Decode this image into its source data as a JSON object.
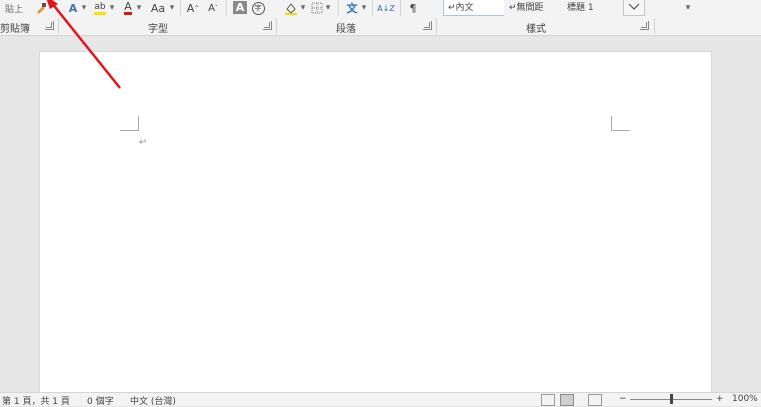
{
  "ribbon": {
    "clipboard": {
      "label": "剪貼簿",
      "paste_label": "貼上",
      "format_painter_icon": "format-painter-icon"
    },
    "font": {
      "label": "字型",
      "text_effects": "A",
      "highlight": "ab",
      "font_color": "A",
      "change_case": "Aa",
      "grow": "A",
      "shrink": "A",
      "char_shading": "A",
      "enclose": "字",
      "dropdown": "▾"
    },
    "paragraph": {
      "label": "段落",
      "shading_icon": "shading-icon",
      "borders_icon": "borders-icon",
      "asian_layout": "文",
      "sort": "A↓Z",
      "show_marks": "¶"
    },
    "styles": {
      "label": "樣式",
      "items": [
        "↵內文",
        "↵無間距",
        "標題 1"
      ],
      "more": "▾"
    }
  },
  "document": {
    "paragraph_mark": "↵"
  },
  "status_bar": {
    "page_info": "第 1 頁，共 1 頁",
    "word_count": "0 個字",
    "language": "中文 (台灣)",
    "zoom_minus": "−",
    "zoom_plus": "+",
    "zoom_level": "100%",
    "zoom_fraction": 0.5
  },
  "annotation": {
    "color": "#e3151a"
  }
}
